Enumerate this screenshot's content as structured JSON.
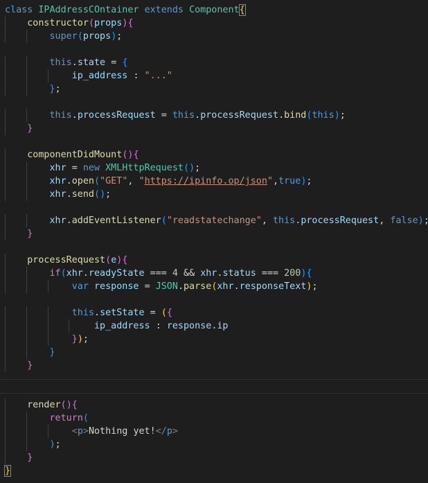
{
  "editor": {
    "language": "javascript",
    "theme": "dark",
    "lines": [
      "class IPAddressCOntainer extends Component{",
      "    constructor(props){",
      "        super(props);",
      "",
      "        this.state = {",
      "            ip_address : \"...\"",
      "        };",
      "",
      "        this.processRequest = this.processRequest.bind(this);",
      "    }",
      "",
      "    componentDidMount(){",
      "        xhr = new XMLHttpRequest();",
      "        xhr.open(\"GET\", \"https://ipinfo.op/json\",true);",
      "        xhr.send();",
      "",
      "        xhr.addEventListener(\"readstatechange\", this.processRequest, false);",
      "    }",
      "",
      "    processRequest(e){",
      "        if(xhr.readyState === 4 && xhr.status === 200){",
      "            var response = JSON.parse(xhr.responseText);",
      "",
      "            this.setState = ({",
      "                ip_address : response.ip",
      "            });",
      "        }",
      "    }",
      "",
      "",
      "    render(){",
      "        return(",
      "            <p>Nothing yet!</p>",
      "        );",
      "    }",
      "}"
    ]
  },
  "colors": {
    "background": "#1e1e1e",
    "keyword": "#569cd6",
    "control": "#c586c0",
    "type": "#4ec9b0",
    "function": "#dcdcaa",
    "variable": "#9cdcfe",
    "string": "#ce9178",
    "number": "#b5cea8"
  }
}
